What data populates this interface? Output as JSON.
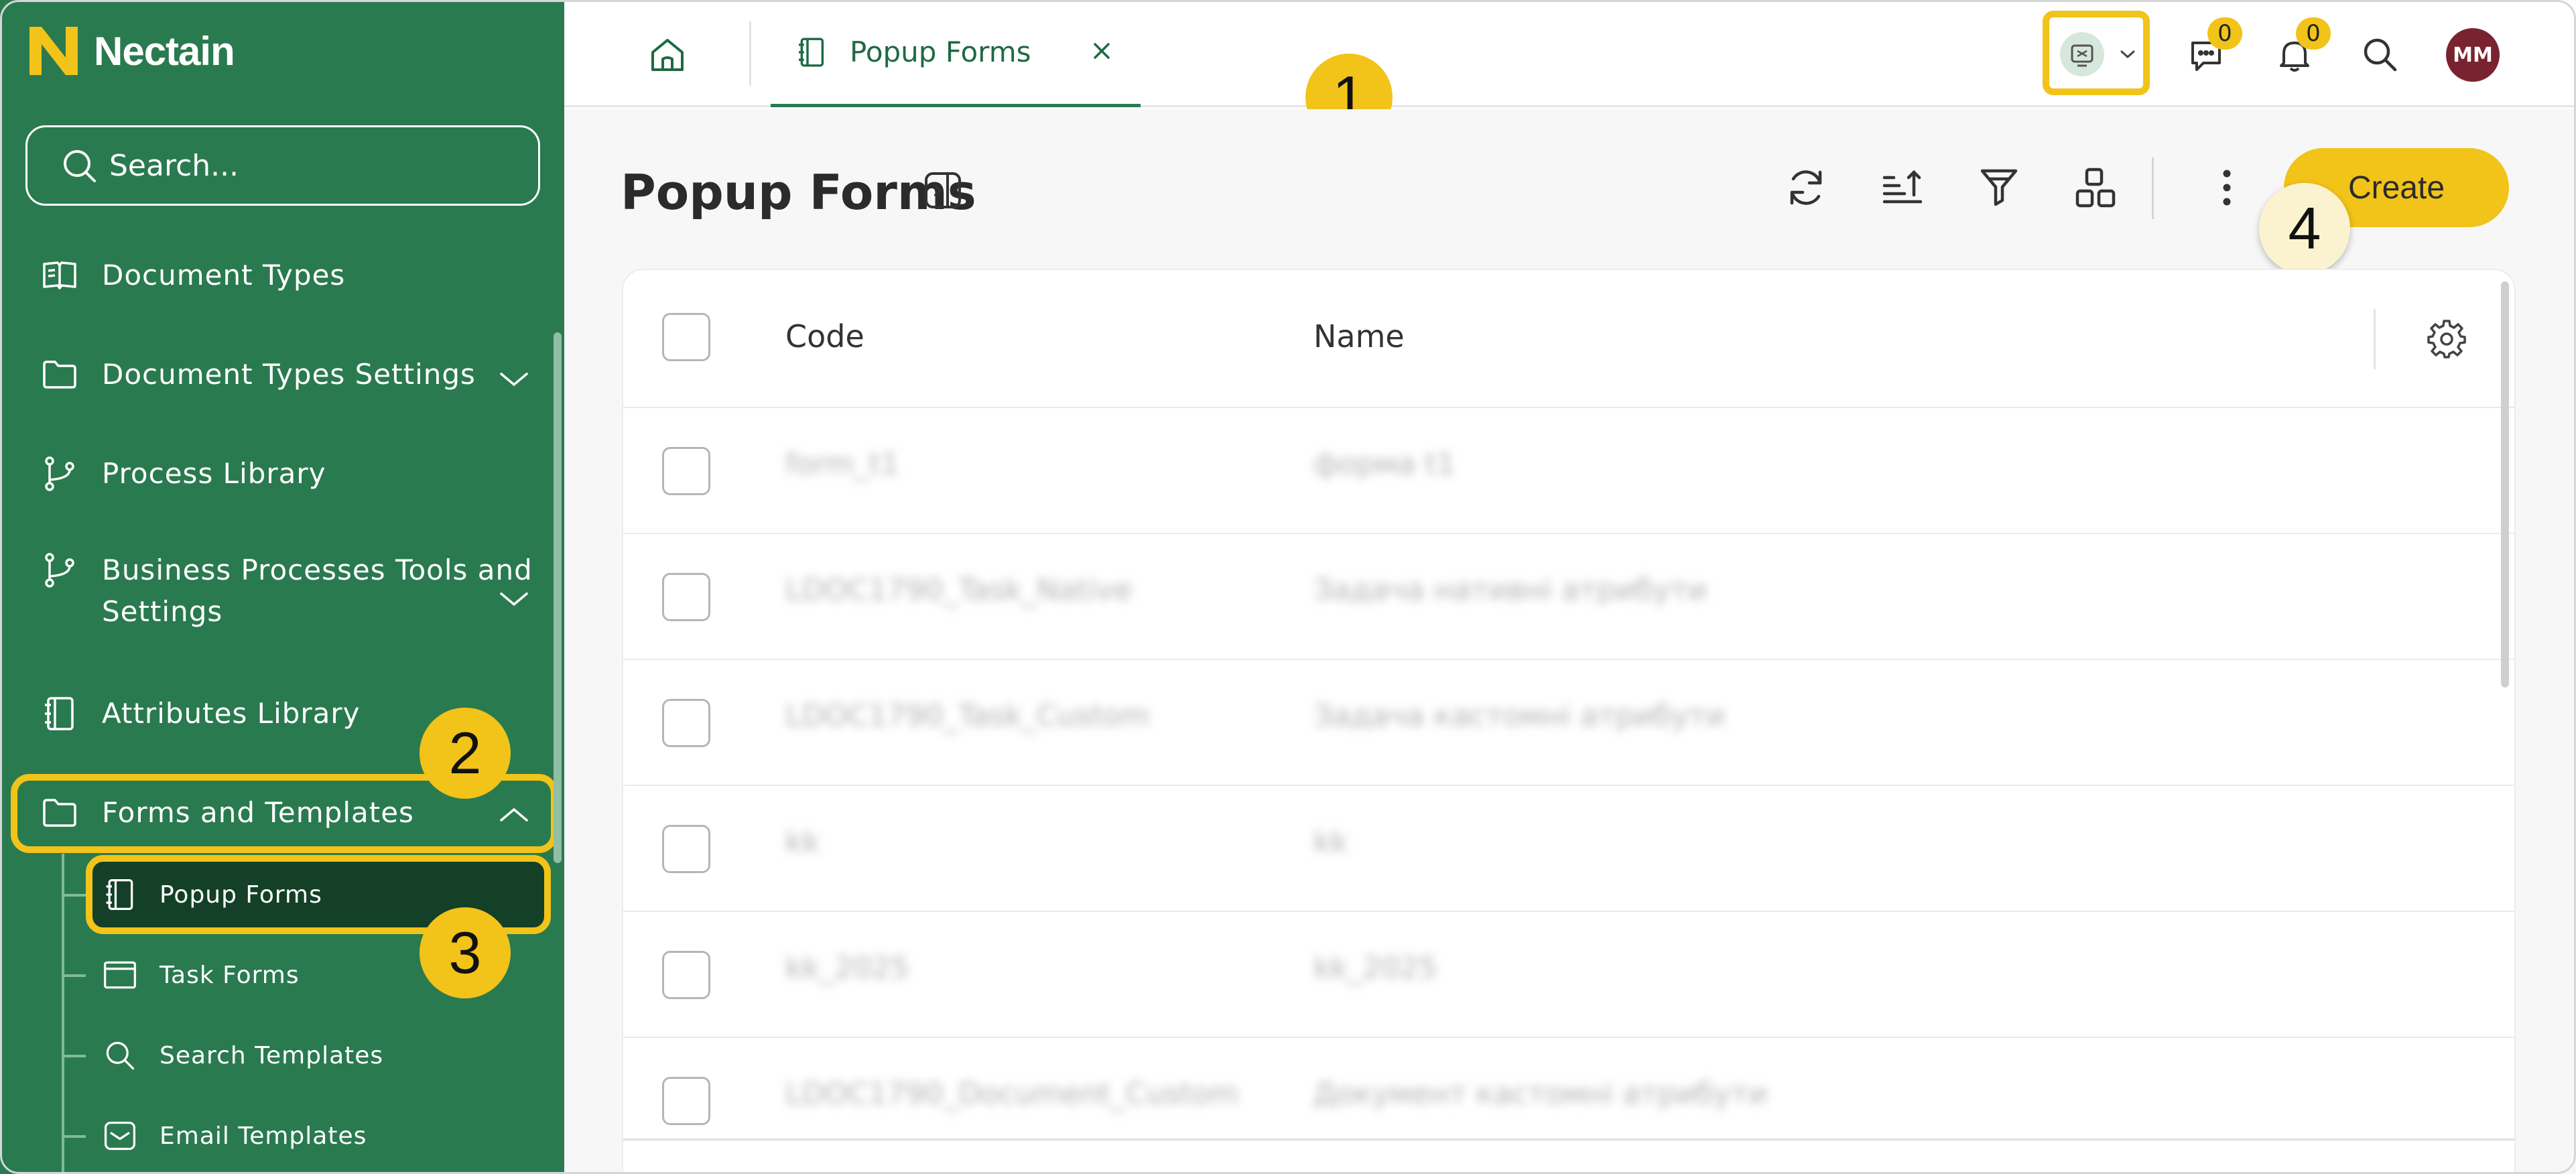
{
  "app": {
    "name": "Nectain",
    "brand_color": "#2a7a4f",
    "accent_color": "#f2c318"
  },
  "sidebar": {
    "search_placeholder": "Search...",
    "items": [
      {
        "label": "Document Types",
        "icon": "book-open-icon"
      },
      {
        "label": "Document Types Settings",
        "icon": "folder-icon",
        "expandable": true
      },
      {
        "label": "Process Library",
        "icon": "git-branch-icon"
      },
      {
        "label": "Business Processes Tools and",
        "label_line2": "Settings",
        "icon": "git-branch-icon",
        "expandable": true
      },
      {
        "label": "Attributes Library",
        "icon": "notebook-icon"
      },
      {
        "label": "Forms and Templates",
        "icon": "folder-icon",
        "expanded": true
      }
    ],
    "sub_items": [
      {
        "label": "Popup Forms",
        "icon": "notebook-icon",
        "active": true
      },
      {
        "label": "Task Forms",
        "icon": "window-icon"
      },
      {
        "label": "Search Templates",
        "icon": "search-icon"
      },
      {
        "label": "Email Templates",
        "icon": "mail-icon"
      }
    ]
  },
  "topbar": {
    "tab_label": "Popup Forms",
    "messages_count": "0",
    "notifications_count": "0",
    "user_initials": "MM"
  },
  "main": {
    "title": "Popup Forms",
    "create_label": "Create",
    "columns": [
      "Code",
      "Name"
    ],
    "rows": [
      {
        "code": "form_t1",
        "name": "форма t1"
      },
      {
        "code": "LDOC1790_Task_Native",
        "name": "Задача нативні атрибути"
      },
      {
        "code": "LDOC1790_Task_Custom",
        "name": "Задача кастомні атрибути"
      },
      {
        "code": "kk",
        "name": "kk"
      },
      {
        "code": "kk_2025",
        "name": "kk_2025"
      },
      {
        "code": "LDOC1790_Document_Custom",
        "name": "Документ кастомні атрибути"
      }
    ]
  },
  "annotations": [
    "1",
    "2",
    "3",
    "4"
  ]
}
